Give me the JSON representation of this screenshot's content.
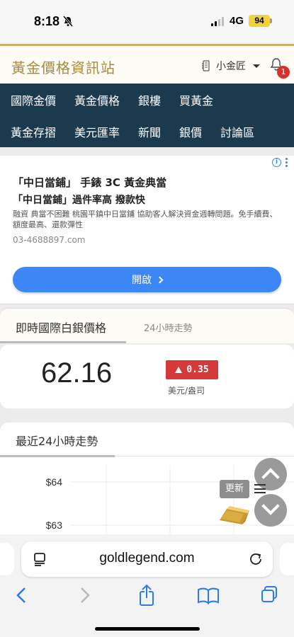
{
  "status_bar": {
    "time": "8:18",
    "network": "4G",
    "battery": "94"
  },
  "header": {
    "site_title": "黃金價格資訊站",
    "user_name": "小金匠",
    "notification_count": "1"
  },
  "nav": {
    "row1": [
      "國際金價",
      "黃金價格",
      "銀樓",
      "買黃金"
    ],
    "row2": [
      "黃金存摺",
      "美元匯率",
      "新聞",
      "銀價",
      "討論區"
    ]
  },
  "ad": {
    "headline1": "「中日當鋪」 手錶 3C 黃金典當",
    "headline2": "「中日當鋪」過件率高 撥款快",
    "description": "融資 典當不困難 桃園平鎮中日當鋪 協助客人解決資金週轉問題。免手續費、額度最高、還款彈性",
    "phone": "03-4688897.com",
    "button_label": "開啟"
  },
  "price_tabs": {
    "active": "即時國際白銀價格",
    "other": "24小時走勢"
  },
  "price": {
    "value": "62.16",
    "change": "0.35",
    "unit": "美元/盎司",
    "change_color": "#d43a3a"
  },
  "chart_section": {
    "title": "最近24小時走勢"
  },
  "chart_data": {
    "type": "line",
    "title": "",
    "xlabel": "",
    "ylabel": "",
    "y_ticks": [
      "$64",
      "$63"
    ],
    "y_tick_values": [
      64,
      63
    ],
    "x": [],
    "series": []
  },
  "floating": {
    "update_label": "更新"
  },
  "browser": {
    "url": "goldlegend.com"
  },
  "colors": {
    "nav_bg": "#1c3a4e",
    "gold": "#a88a3a",
    "ad_button": "#3d86f5"
  }
}
